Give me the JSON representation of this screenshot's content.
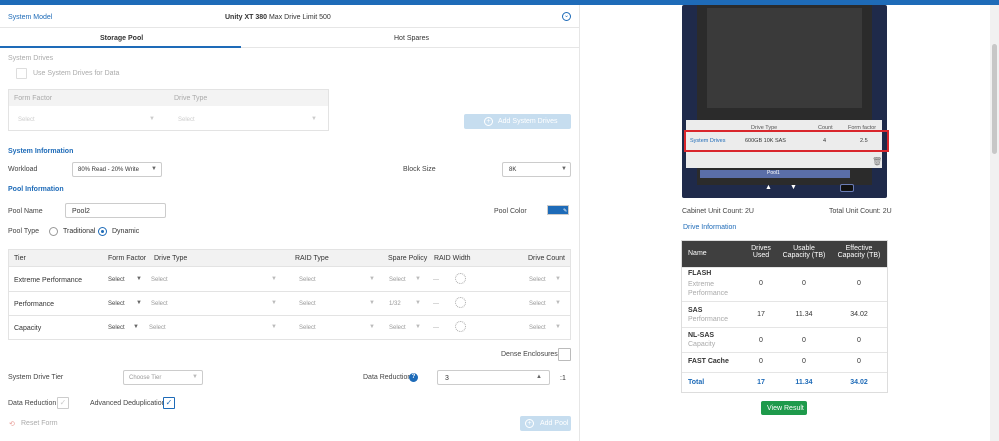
{
  "system_model": {
    "label": "System Model",
    "product": "Unity XT 380",
    "limit": "Max Drive Limit 500"
  },
  "tabs": [
    {
      "label": "Storage Pool"
    },
    {
      "label": "Hot Spares"
    }
  ],
  "system_drives": {
    "title": "System Drives",
    "checkbox_label": "Use System Drives for Data",
    "form_factor_label": "Form Factor",
    "drive_type_label": "Drive Type",
    "select": "Select",
    "add_button": "Add System Drives"
  },
  "system_info": {
    "title": "System Information",
    "workload_label": "Workload",
    "workload_value": "80% Read - 20% Write",
    "block_label": "Block Size",
    "block_value": "8K"
  },
  "pool_info": {
    "title": "Pool Information",
    "name_label": "Pool Name",
    "name_value": "Pool2",
    "color_label": "Pool Color",
    "type_label": "Pool Type",
    "traditional": "Traditional",
    "dynamic": "Dynamic"
  },
  "tier_table": {
    "headers": [
      "Tier",
      "Form Factor",
      "Drive Type",
      "RAID Type",
      "Spare Policy",
      "RAID Width",
      "Drive Count"
    ],
    "rows": [
      {
        "tier": "Extreme Performance",
        "ff": "Select",
        "dt": "Select",
        "raid": "Select",
        "spare": "Select",
        "width": "---",
        "count": "Select"
      },
      {
        "tier": "Performance",
        "ff": "Select",
        "dt": "Select",
        "raid": "Select",
        "spare": "1/32",
        "width": "---",
        "count": "Select"
      },
      {
        "tier": "Capacity",
        "ff": "Select",
        "dt": "Select",
        "raid": "Select",
        "spare": "Select",
        "width": "---",
        "count": "Select"
      }
    ]
  },
  "bottom": {
    "dense": "Dense Enclosures",
    "sdt_label": "System Drive Tier",
    "sdt_value": "Choose Tier",
    "dr_label": "Data Reduction",
    "dr_value": "3",
    "dr_suffix": ":1",
    "dr_check": "Data Reduction",
    "dedup_check": "Advanced Deduplication",
    "reset": "Reset Form",
    "add_pool": "Add Pool"
  },
  "overlay": {
    "headers": [
      "Drive Type",
      "Count",
      "Form factor"
    ],
    "row": {
      "name": "System Drives",
      "type": "600GB 10K SAS",
      "count": "4",
      "ff": "2.5"
    },
    "pool_label": "Pool1"
  },
  "units": {
    "cabinet": "Cabinet Unit Count: 2U",
    "total": "Total Unit Count: 2U"
  },
  "drive_info": {
    "title": "Drive Information",
    "headers": [
      "Name",
      "Drives Used",
      "Usable Capacity (TB)",
      "Effective Capacity (TB)"
    ],
    "rows": [
      {
        "name": "FLASH",
        "sub": "Extreme Performance",
        "used": "0",
        "usable": "0",
        "effective": "0"
      },
      {
        "name": "SAS",
        "sub": "Performance",
        "used": "17",
        "usable": "11.34",
        "effective": "34.02"
      },
      {
        "name": "NL-SAS",
        "sub": "Capacity",
        "used": "0",
        "usable": "0",
        "effective": "0"
      },
      {
        "name": "FAST Cache",
        "sub": "",
        "used": "0",
        "usable": "0",
        "effective": "0"
      }
    ],
    "total": {
      "name": "Total",
      "used": "17",
      "usable": "11.34",
      "effective": "34.02"
    }
  },
  "view_result": "View Result"
}
